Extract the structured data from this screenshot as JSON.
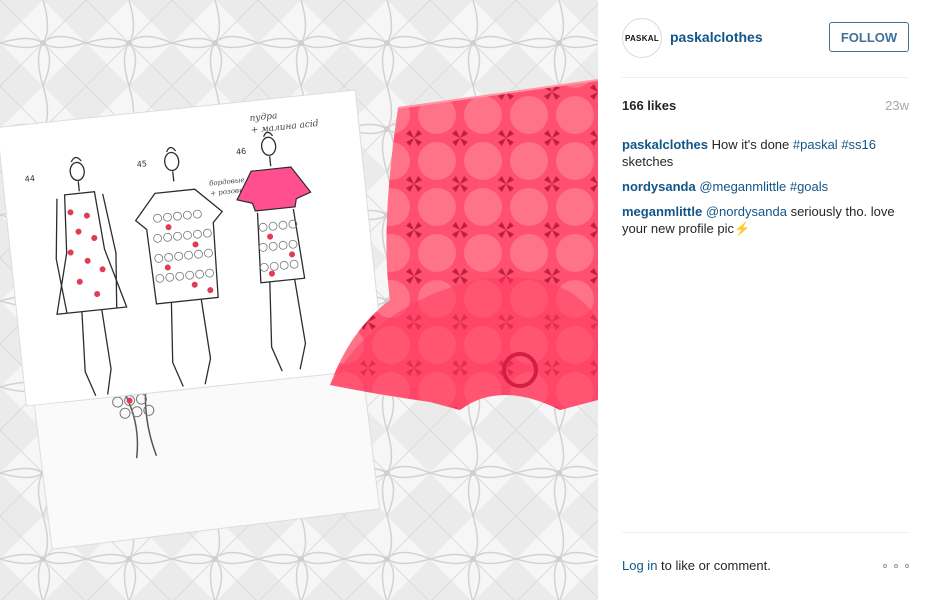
{
  "post": {
    "image_alt_icon": "post-photo",
    "sketch_numbers": [
      "44",
      "45",
      "46"
    ],
    "sketch_notes": [
      "пудра",
      "+ малина acid",
      "бордовые",
      "+ розовые"
    ]
  },
  "header": {
    "avatar_text": "PASKAL",
    "username": "paskalclothes",
    "follow_label": "FOLLOW"
  },
  "stats": {
    "likes": "166 likes",
    "age": "23w"
  },
  "comments": [
    {
      "user": "paskalclothes",
      "parts": {
        "t1": "How it's done",
        "tag1": "#paskal",
        "tag2": "#ss16",
        "t2": "sketches"
      }
    },
    {
      "user": "nordysanda",
      "parts": {
        "mention": "@meganmlittle",
        "tag": "#goals"
      }
    },
    {
      "user": "meganmlittle",
      "parts": {
        "mention": "@nordysanda",
        "text": "seriously tho. love your new profile pic⚡"
      }
    }
  ],
  "footer": {
    "login_link": "Log in",
    "login_text": "to like or comment.",
    "more_icon": "more-options-icon"
  },
  "colors": {
    "link": "#125688",
    "follow_border": "#3f729b",
    "pink_paper": "#ff4f6e"
  }
}
